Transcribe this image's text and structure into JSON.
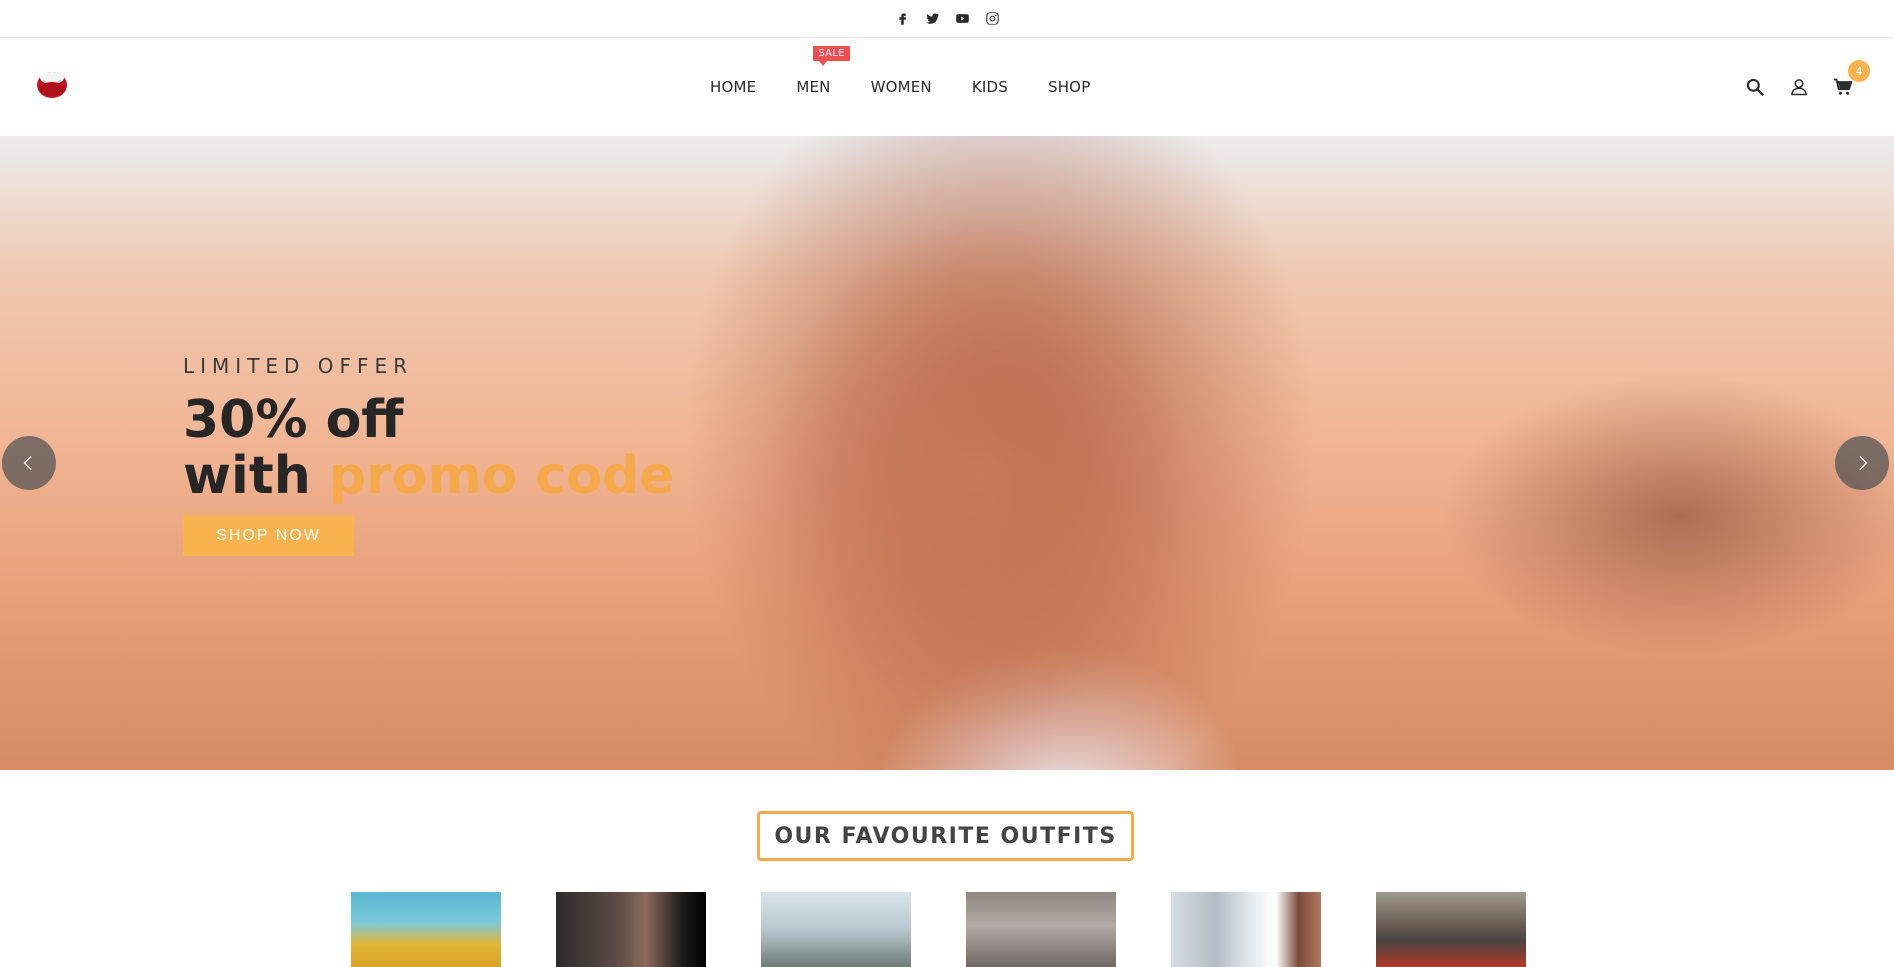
{
  "social": [
    {
      "name": "facebook-icon"
    },
    {
      "name": "twitter-icon"
    },
    {
      "name": "youtube-icon"
    },
    {
      "name": "instagram-icon"
    }
  ],
  "nav": {
    "items": [
      {
        "label": "HOME"
      },
      {
        "label": "MEN",
        "badge": "SALE"
      },
      {
        "label": "WOMEN"
      },
      {
        "label": "KIDS"
      },
      {
        "label": "SHOP"
      }
    ]
  },
  "header": {
    "cart_count": "4"
  },
  "hero": {
    "eyebrow": "LIMITED OFFER",
    "title_line1": "30% off",
    "title_line2_prefix": "with",
    "title_line2_highlight": "promo code",
    "button": "SHOP NOW"
  },
  "section": {
    "title": "OUR FAVOURITE OUTFITS"
  },
  "colors": {
    "accent": "#f8b24e",
    "sale": "#ef4f4f",
    "text_dark": "#262626"
  }
}
